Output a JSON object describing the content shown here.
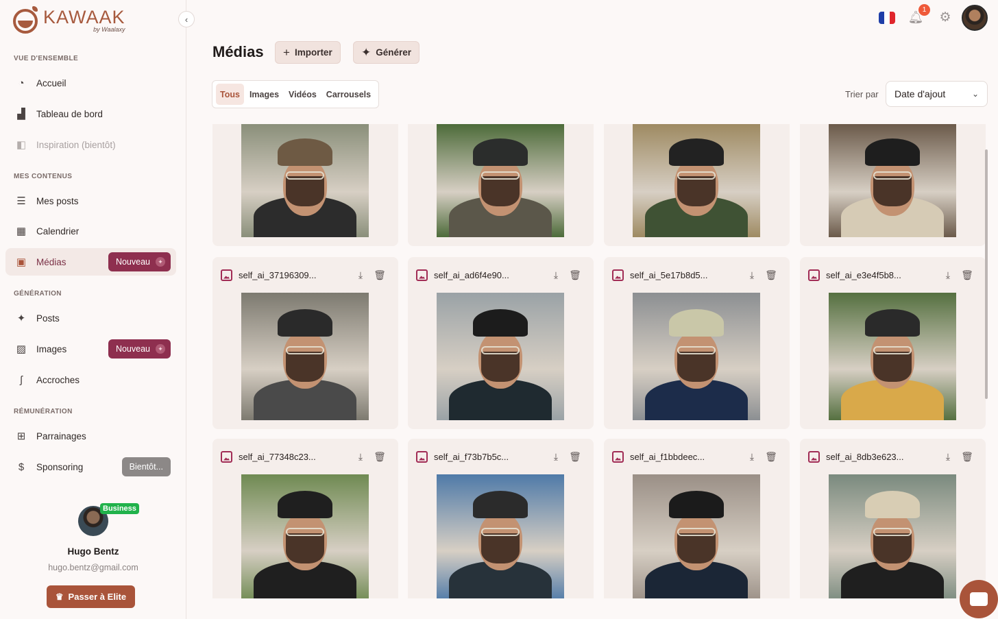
{
  "brand": {
    "name": "KAWAAK",
    "sub": "by Waalaxy"
  },
  "sidebar": {
    "sections": [
      {
        "title": "VUE D'ENSEMBLE"
      },
      {
        "title": "MES CONTENUS"
      },
      {
        "title": "GÉNÉRATION"
      },
      {
        "title": "RÉMUNÉRATION"
      }
    ],
    "items": [
      {
        "label": "Accueil",
        "icon": "gauge-icon"
      },
      {
        "label": "Tableau de bord",
        "icon": "chart-icon"
      },
      {
        "label": "Inspiration (bientôt)",
        "icon": "bookmark-icon"
      },
      {
        "label": "Mes posts",
        "icon": "list-icon"
      },
      {
        "label": "Calendrier",
        "icon": "calendar-icon"
      },
      {
        "label": "Médias",
        "icon": "media-icon",
        "badge": "Nouveau"
      },
      {
        "label": "Posts",
        "icon": "sparkles-icon"
      },
      {
        "label": "Images",
        "icon": "image-sparkle-icon",
        "badge": "Nouveau"
      },
      {
        "label": "Accroches",
        "icon": "hook-icon"
      },
      {
        "label": "Parrainages",
        "icon": "gift-icon"
      },
      {
        "label": "Sponsoring",
        "icon": "dollar-icon",
        "badge": "Bientôt..."
      }
    ]
  },
  "profile": {
    "plan": "Business",
    "name": "Hugo Bentz",
    "email": "hugo.bentz@gmail.com",
    "upgrade_label": "Passer à Elite"
  },
  "topbar": {
    "notifications": "1"
  },
  "main": {
    "title": "Médias",
    "import_label": "Importer",
    "generate_label": "Générer",
    "tabs": [
      "Tous",
      "Images",
      "Vidéos",
      "Carrousels"
    ],
    "sort_label": "Trier par",
    "sort_value": "Date d'ajout"
  },
  "media": [
    {
      "name": "",
      "cap": "#6e5a44",
      "shirt": "#2c2c2c",
      "bg": "#8a8f7a"
    },
    {
      "name": "",
      "cap": "#2b2d2c",
      "shirt": "#5b574a",
      "bg": "#4d6b3a"
    },
    {
      "name": "",
      "cap": "#222222",
      "shirt": "#3f5234",
      "bg": "#9e8a62"
    },
    {
      "name": "",
      "cap": "#1e1e1e",
      "shirt": "#d6cbb5",
      "bg": "#6b5a4a"
    },
    {
      "name": "self_ai_37196309...",
      "cap": "#2a2a2a",
      "shirt": "#4a4a4a",
      "bg": "#7d7a70"
    },
    {
      "name": "self_ai_ad6f4e90...",
      "cap": "#1c1c1c",
      "shirt": "#1f2a30",
      "bg": "#9aa2a6"
    },
    {
      "name": "self_ai_5e17b8d5...",
      "cap": "#c9c7a8",
      "shirt": "#1c2c4a",
      "bg": "#8c8f92"
    },
    {
      "name": "self_ai_e3e4f5b8...",
      "cap": "#2a2a2a",
      "shirt": "#d9a94a",
      "bg": "#557040"
    },
    {
      "name": "self_ai_77348c23...",
      "cap": "#1f1f1f",
      "shirt": "#1f1f1f",
      "bg": "#6f8a52"
    },
    {
      "name": "self_ai_f73b7b5c...",
      "cap": "#2b2b2b",
      "shirt": "#27323a",
      "bg": "#4f7aa8"
    },
    {
      "name": "self_ai_f1bbdeec...",
      "cap": "#1b1b1b",
      "shirt": "#1b2636",
      "bg": "#9a8f86"
    },
    {
      "name": "self_ai_8db3e623...",
      "cap": "#d8cdb4",
      "shirt": "#1f1f1f",
      "bg": "#7a8a7e"
    }
  ]
}
